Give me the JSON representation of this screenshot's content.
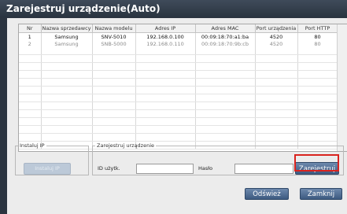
{
  "window": {
    "title": "Zarejestruj urządzenie(Auto)"
  },
  "table": {
    "columns": [
      "Nr",
      "Nazwa sprzedawcy",
      "Nazwa modelu",
      "Adres IP",
      "Adres MAC",
      "Port urządzenia",
      "Port HTTP"
    ],
    "rows": [
      [
        "1",
        "Samsung",
        "SNV-5010",
        "192.168.0.100",
        "00:09:18:70:a1:ba",
        "4520",
        "80"
      ],
      [
        "2",
        "Samsung",
        "SNB-5000",
        "192.168.0.110",
        "00:09:18:70:9b:cb",
        "4520",
        "80"
      ]
    ]
  },
  "install_ip": {
    "legend": "Instaluj IP",
    "button_label": "Instaluj IP"
  },
  "register": {
    "legend": "Zarejestruj urządzenie",
    "user_id_label": "ID użytk.",
    "user_id_value": "",
    "password_label": "Hasło",
    "password_value": "",
    "button_label": "Zarejestruj"
  },
  "footer": {
    "refresh_label": "Odśwież",
    "close_label": "Zamknij"
  },
  "colors": {
    "highlight": "#d9231f",
    "title_bar": "#2b3440"
  }
}
